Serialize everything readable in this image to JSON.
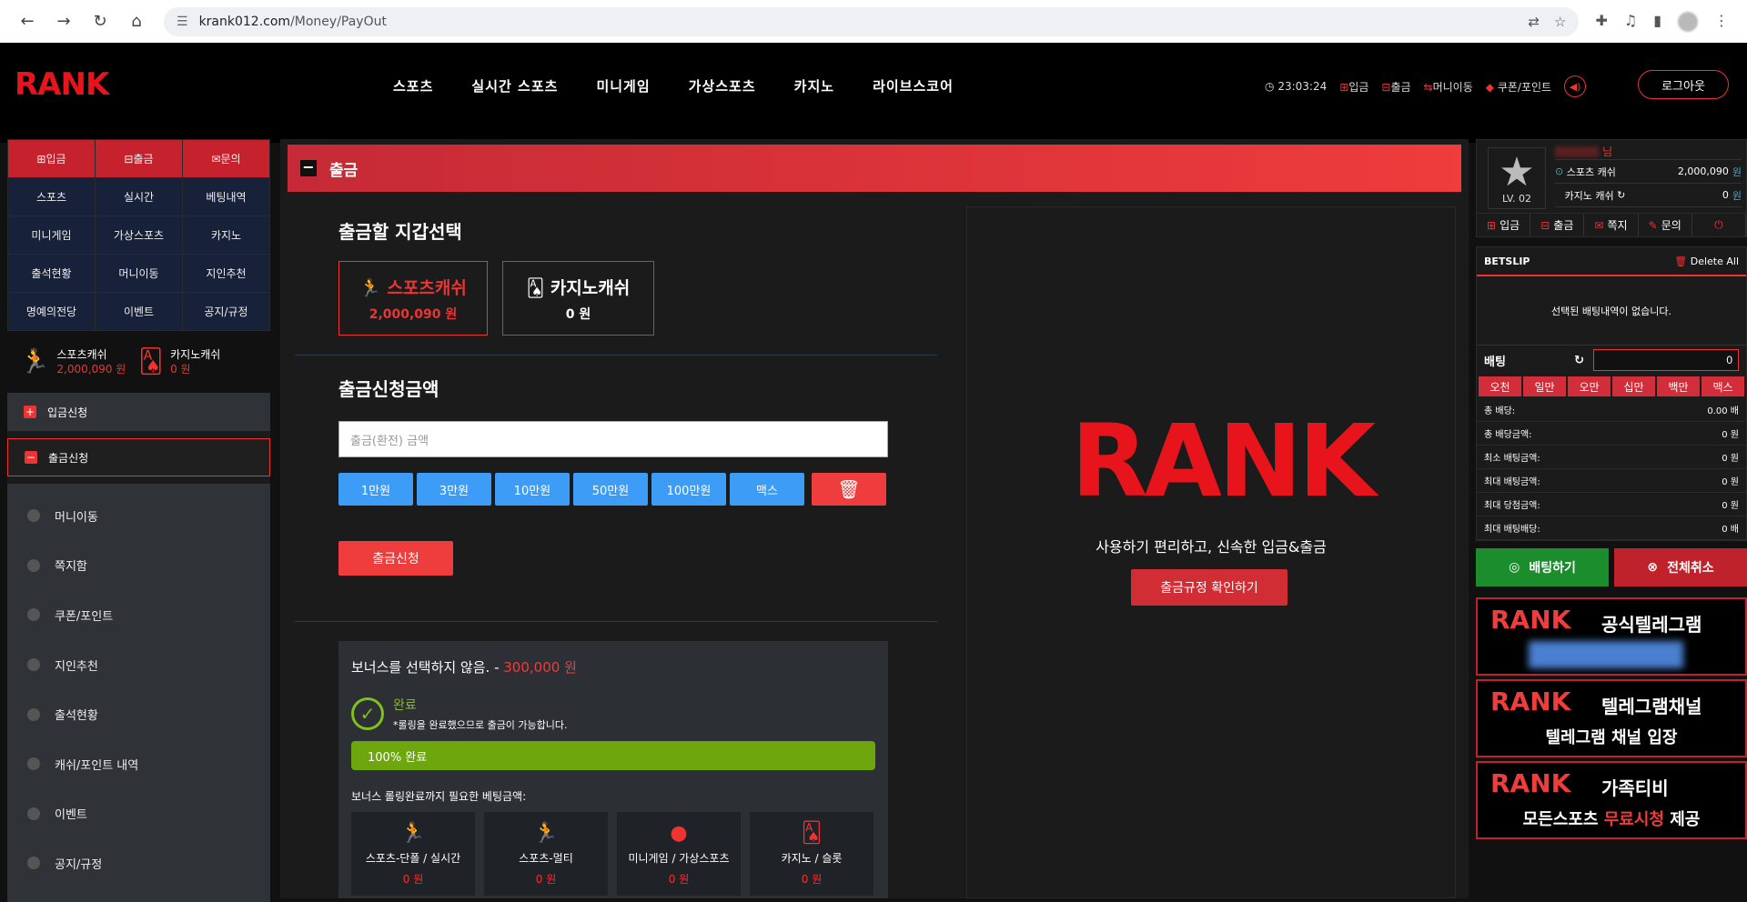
{
  "browser": {
    "url_host": "krank012.com",
    "url_path": "/Money/PayOut"
  },
  "header": {
    "logo": "RANK",
    "menu": [
      "스포츠",
      "실시간 스포츠",
      "미니게임",
      "가상스포츠",
      "카지노",
      "라이브스코어"
    ],
    "time": "23:03:24",
    "deposit": "입금",
    "withdraw": "출금",
    "money_move": "머니이동",
    "coupon_point": "쿠폰/포인트",
    "logout": "로그아웃"
  },
  "left": {
    "top_buttons": [
      "입금",
      "출금",
      "문의"
    ],
    "grid": [
      "스포츠",
      "실시간",
      "베팅내역",
      "미니게임",
      "가상스포츠",
      "카지노",
      "출석현황",
      "머니이동",
      "지인추천",
      "명예의전당",
      "이벤트",
      "공지/규정"
    ],
    "sports_cash_label": "스포츠캐쉬",
    "sports_cash": "2,000,090 원",
    "casino_cash_label": "카지노캐쉬",
    "casino_cash": "0 원",
    "deposit_req": "입금신청",
    "withdraw_req": "출금신청",
    "sub_items": [
      "머니이동",
      "쪽지함",
      "쿠폰/포인트",
      "지인추천",
      "출석현황",
      "캐쉬/포인트 내역",
      "이벤트",
      "공지/규정"
    ]
  },
  "main": {
    "title": "출금",
    "wallet_title": "출금할 지갑선택",
    "wallet_sports": "스포츠캐쉬",
    "wallet_sports_amount": "2,000,090 원",
    "wallet_casino": "카지노캐쉬",
    "wallet_casino_amount": "0 원",
    "amount_title": "출금신청금액",
    "amount_placeholder": "출금(환전) 금액",
    "quick": [
      "1만원",
      "3만원",
      "10만원",
      "50만원",
      "100만원",
      "맥스"
    ],
    "submit": "출금신청",
    "bonus_title": "보너스를 선택하지 않음. - ",
    "bonus_amount": "300,000 원",
    "done": "완료",
    "done_msg": "*롤링을 완료했으므로 출금이 가능합니다.",
    "progress": "100% 완료",
    "progress_value": 100,
    "need": "보너스 롤링완료까지 필요한 베팅금액:",
    "cats": [
      {
        "label": "스포츠-단폴 / 실시간",
        "value": "0 원"
      },
      {
        "label": "스포츠-멀티",
        "value": "0 원"
      },
      {
        "label": "미니게임 / 가상스포츠",
        "value": "0 원"
      },
      {
        "label": "카지노 / 슬롯",
        "value": "0 원"
      }
    ],
    "promo_logo": "RANK",
    "promo_msg": "사용하기 편리하고, 신속한 입금&출금",
    "promo_btn": "출금규정 확인하기"
  },
  "right": {
    "nick_suffix": "님",
    "level": "LV. 02",
    "sports_cash_label": "스포츠 캐쉬",
    "sports_cash": "2,000,090",
    "won": "원",
    "casino_cash_label": "카지노 캐쉬",
    "casino_cash": "0",
    "actions": [
      "입금",
      "출금",
      "쪽지",
      "문의"
    ],
    "betslip": "BETSLIP",
    "delete_all": "Delete All",
    "empty": "선택된 배팅내역이 없습니다.",
    "bet_label": "배팅",
    "bet_value": "0",
    "chips": [
      "오천",
      "일만",
      "오만",
      "십만",
      "백만",
      "맥스"
    ],
    "info": [
      {
        "k": "총 배당:",
        "v": "0.00 배"
      },
      {
        "k": "총 배당금액:",
        "v": "0 원"
      },
      {
        "k": "최소 배팅금액:",
        "v": "0 원"
      },
      {
        "k": "최대 배팅금액:",
        "v": "0 원"
      },
      {
        "k": "최대 당첨금액:",
        "v": "0 원"
      },
      {
        "k": "최대 배팅배당:",
        "v": "0 배"
      }
    ],
    "bet_btn": "배팅하기",
    "cancel_btn": "전체취소",
    "banners": [
      {
        "logo": "RANK",
        "title": "공식텔레그램",
        "sub": ""
      },
      {
        "logo": "RANK",
        "title": "텔레그램채널",
        "sub": "텔레그램 채널 입장"
      },
      {
        "logo": "RANK",
        "title": "가족티비",
        "sub_a": "모든스포츠 ",
        "sub_b": "무료시청",
        "sub_c": " 제공"
      }
    ]
  }
}
